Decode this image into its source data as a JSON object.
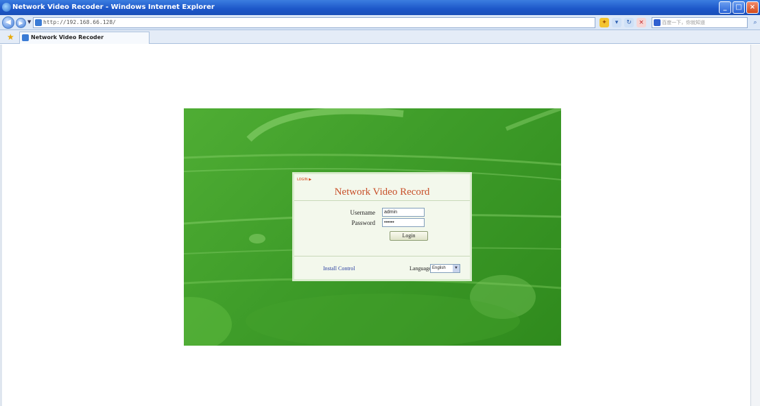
{
  "window": {
    "title": "Network Video Recoder - Windows Internet Explorer"
  },
  "addressbar": {
    "url": "http://192.168.66.128/",
    "search_placeholder": "百度一下，你就知道"
  },
  "tabs": [
    {
      "label": "Network Video Recoder"
    }
  ],
  "login": {
    "tag": "LOGIN ▶",
    "title": "Network Video Record",
    "username_label": "Username",
    "username_value": "admin",
    "password_label": "Password",
    "password_value": "••••••",
    "login_button": "Login",
    "install_link": "Install Control",
    "language_label": "Language",
    "language_value": "English"
  },
  "colors": {
    "banner_green": "#3e9c29",
    "title_red": "#c8502a",
    "link_blue": "#2a3fa0"
  }
}
